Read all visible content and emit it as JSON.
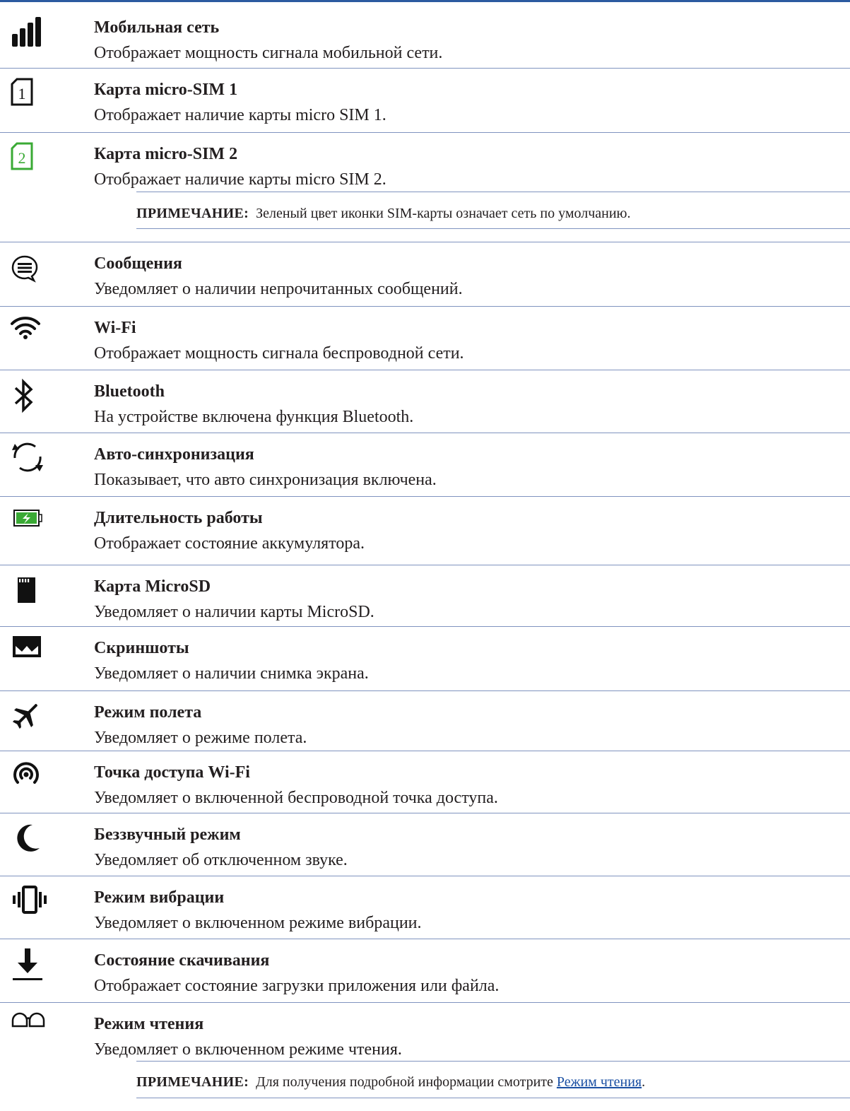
{
  "items": [
    {
      "title": "Мобильная сеть",
      "desc": "Отображает мощность сигнала мобильной сети.",
      "icon": "signal-bars-icon"
    },
    {
      "title": "Карта micro-SIM 1",
      "desc": "Отображает наличие карты micro SIM 1.",
      "icon": "sim1-icon"
    },
    {
      "title": "Карта micro-SIM 2",
      "desc": "Отображает наличие карты micro SIM 2.",
      "icon": "sim2-icon"
    },
    {
      "title": "Сообщения",
      "desc": "Уведомляет о наличии непрочитанных сообщений.",
      "icon": "message-bubble-icon"
    },
    {
      "title": "Wi-Fi",
      "desc": "Отображает мощность сигнала беспроводной сети.",
      "icon": "wifi-icon"
    },
    {
      "title": "Bluetooth",
      "desc": "На устройстве включена функция Bluetooth.",
      "icon": "bluetooth-icon"
    },
    {
      "title": "Авто-синхронизация",
      "desc": "Показывает, что авто синхронизация включена.",
      "icon": "sync-icon"
    },
    {
      "title": "Длительность работы",
      "desc": "Отображает состояние аккумулятора.",
      "icon": "battery-charging-icon"
    },
    {
      "title": "Карта MicroSD",
      "desc": "Уведомляет о наличии карты MicroSD.",
      "icon": "sd-card-icon"
    },
    {
      "title": "Скриншоты",
      "desc": "Уведомляет о наличии снимка экрана.",
      "icon": "screenshot-icon"
    },
    {
      "title": "Режим полета",
      "desc": "Уведомляет о режиме полета.",
      "icon": "airplane-icon"
    },
    {
      "title": "Точка доступа Wi-Fi",
      "desc": "Уведомляет о включенной беспроводной точка доступа.",
      "icon": "hotspot-icon"
    },
    {
      "title": "Беззвучный режим",
      "desc": "Уведомляет об отключенном звуке.",
      "icon": "moon-icon"
    },
    {
      "title": "Режим вибрации",
      "desc": "Уведомляет о включенном режиме вибрации.",
      "icon": "vibrate-icon"
    },
    {
      "title": "Состояние скачивания",
      "desc": "Отображает состояние загрузки приложения или файла.",
      "icon": "download-icon"
    },
    {
      "title": "Режим чтения",
      "desc": "Уведомляет о включенном режиме чтения.",
      "icon": "reading-glasses-icon"
    }
  ],
  "notes": {
    "sim": {
      "label": "ПРИМЕЧАНИЕ:",
      "text": "Зеленый цвет иконки SIM-карты означает сеть по умолчанию."
    },
    "reading": {
      "label": "ПРИМЕЧАНИЕ:",
      "text": "Для получения подробной информации смотрите ",
      "link": "Режим чтения",
      "after": "."
    }
  },
  "colors": {
    "rule": "#2c5aa0",
    "separator": "#7f93bf",
    "sim_default_green": "#3aaa35",
    "link": "#1a4fa3"
  }
}
